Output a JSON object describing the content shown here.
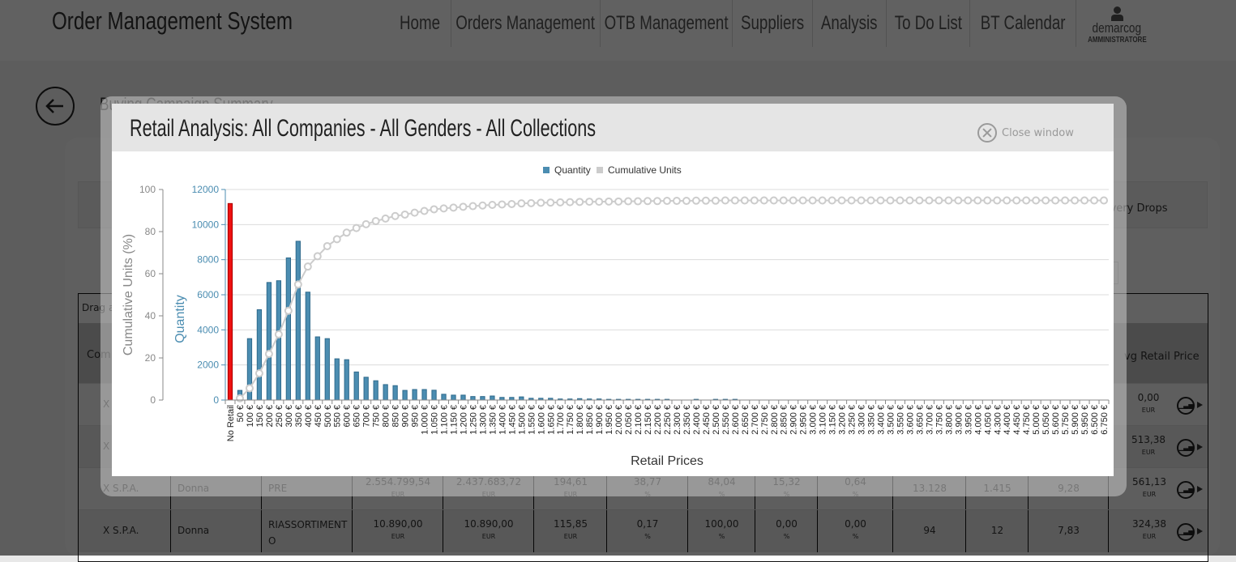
{
  "header": {
    "app_title": "Order Management System",
    "nav": [
      "Home",
      "Orders Management",
      "OTB Management",
      "Suppliers",
      "Analysis",
      "To Do List",
      "BT Calendar"
    ],
    "user": {
      "name": "demarcog",
      "role": "AMMINISTRATORE"
    }
  },
  "page": {
    "heading": "Buying Campaign Summary",
    "tab_partial": "ivery Drops",
    "grid": {
      "drag_hint": "Drag a",
      "col_company": "Comp",
      "col_avg_retail": "vg Retail Price",
      "rows": [
        {
          "company": "X",
          "gender": "",
          "type": "",
          "vals": [],
          "avg": "0,00",
          "avg_unit": "EUR"
        },
        {
          "company": "X",
          "gender": "",
          "type": "",
          "vals": [],
          "avg": "513,38",
          "avg_unit": "EUR"
        },
        {
          "company": "X S.P.A.",
          "gender": "Donna",
          "type": "PRE",
          "v1": "2.554.799,54",
          "u1": "EUR",
          "v2": "2.437.683,72",
          "u2": "EUR",
          "v3": "194,61",
          "u3": "EUR",
          "v4": "38,77",
          "u4": "%",
          "v5": "84,04",
          "u5": "%",
          "v6": "15,32",
          "u6": "%",
          "v7": "0,64",
          "u7": "%",
          "v8": "13.128",
          "v9": "1.415",
          "v10": "9,28",
          "avg": "561,13",
          "avg_unit": "EUR"
        },
        {
          "company": "X S.P.A.",
          "gender": "Donna",
          "type": "RIASSORTIMENT O",
          "v1": "10.890,00",
          "u1": "EUR",
          "v2": "10.890,00",
          "u2": "EUR",
          "v3": "115,85",
          "u3": "EUR",
          "v4": "0,17",
          "u4": "%",
          "v5": "100,00",
          "u5": "%",
          "v6": "0,00",
          "u6": "%",
          "v7": "0,00",
          "u7": "%",
          "v8": "94",
          "v9": "12",
          "v10": "7,83",
          "avg": "324,38",
          "avg_unit": "EUR"
        }
      ]
    }
  },
  "modal": {
    "title": "Retail Analysis: All Companies - All Genders - All Collections",
    "close_label": "Close window"
  },
  "colors": {
    "quantity": "#4b8db1",
    "no_retail": "#ee1111",
    "cumulative": "#cccccc"
  },
  "chart_data": {
    "type": "bar",
    "xlabel": "Retail Prices",
    "ylabel": "Quantity",
    "y2label": "Cumulative Units (%)",
    "ylim": [
      0,
      12000
    ],
    "y2lim": [
      0,
      100
    ],
    "yticks": [
      "0",
      "2000",
      "4000",
      "6000",
      "8000",
      "10000",
      "12000"
    ],
    "y2ticks": [
      "0",
      "20",
      "40",
      "60",
      "80",
      "100"
    ],
    "legend": [
      "Quantity",
      "Cumulative Units"
    ],
    "legend_position": "top-center",
    "grid": true,
    "categories": [
      "No Retail",
      "50 €",
      "100 €",
      "150 €",
      "200 €",
      "250 €",
      "300 €",
      "350 €",
      "400 €",
      "450 €",
      "500 €",
      "550 €",
      "600 €",
      "650 €",
      "700 €",
      "750 €",
      "800 €",
      "850 €",
      "900 €",
      "950 €",
      "1.000 €",
      "1.050 €",
      "1.100 €",
      "1.150 €",
      "1.200 €",
      "1.250 €",
      "1.300 €",
      "1.350 €",
      "1.400 €",
      "1.450 €",
      "1.500 €",
      "1.550 €",
      "1.600 €",
      "1.650 €",
      "1.700 €",
      "1.750 €",
      "1.800 €",
      "1.850 €",
      "1.900 €",
      "1.950 €",
      "2.000 €",
      "2.050 €",
      "2.100 €",
      "2.150 €",
      "2.200 €",
      "2.250 €",
      "2.300 €",
      "2.350 €",
      "2.400 €",
      "2.450 €",
      "2.500 €",
      "2.550 €",
      "2.600 €",
      "2.650 €",
      "2.700 €",
      "2.750 €",
      "2.800 €",
      "2.850 €",
      "2.900 €",
      "2.950 €",
      "3.000 €",
      "3.100 €",
      "3.150 €",
      "3.200 €",
      "3.250 €",
      "3.300 €",
      "3.350 €",
      "3.400 €",
      "3.500 €",
      "3.550 €",
      "3.600 €",
      "3.650 €",
      "3.700 €",
      "3.750 €",
      "3.800 €",
      "3.900 €",
      "3.950 €",
      "4.000 €",
      "4.050 €",
      "4.300 €",
      "4.400 €",
      "4.450 €",
      "4.750 €",
      "5.000 €",
      "5.050 €",
      "5.600 €",
      "5.750 €",
      "5.900 €",
      "5.950 €",
      "6.500 €",
      "6.750 €"
    ],
    "series": [
      {
        "name": "Quantity",
        "axis": "left",
        "values": [
          11200,
          550,
          3500,
          5150,
          6700,
          6800,
          8100,
          9050,
          6150,
          3600,
          3500,
          2350,
          2300,
          1600,
          1300,
          1100,
          880,
          820,
          550,
          600,
          600,
          560,
          330,
          280,
          280,
          200,
          200,
          230,
          150,
          150,
          180,
          100,
          100,
          100,
          60,
          60,
          80,
          60,
          60,
          40,
          40,
          40,
          40,
          40,
          40,
          40,
          0,
          0,
          40,
          0,
          40,
          40,
          40,
          0,
          0,
          0,
          0,
          0,
          0,
          0,
          0,
          0,
          0,
          0,
          0,
          0,
          0,
          0,
          0,
          0,
          0,
          0,
          0,
          0,
          0,
          0,
          0,
          0,
          0,
          0,
          0,
          0,
          0,
          0,
          0,
          0,
          0,
          0,
          0,
          0,
          0
        ]
      },
      {
        "name": "Cumulative Units",
        "axis": "right",
        "values": [
          null,
          0.8,
          5.6,
          12.7,
          21.9,
          31.2,
          42.4,
          54.9,
          63.4,
          68.3,
          73.1,
          76.4,
          79.5,
          81.7,
          83.5,
          85.0,
          86.2,
          87.4,
          88.1,
          89.0,
          89.8,
          90.6,
          91.0,
          91.4,
          91.8,
          92.1,
          92.4,
          92.7,
          92.9,
          93.1,
          93.4,
          93.5,
          93.7,
          93.8,
          93.9,
          94.0,
          94.1,
          94.2,
          94.2,
          94.3,
          94.3,
          94.4,
          94.4,
          94.5,
          94.5,
          94.6,
          94.6,
          94.6,
          94.7,
          94.7,
          94.7,
          94.8,
          94.8,
          94.8,
          94.8,
          94.8,
          94.8,
          94.8,
          94.8,
          94.8,
          94.8,
          94.8,
          94.8,
          94.8,
          94.8,
          94.8,
          94.8,
          94.8,
          94.8,
          94.8,
          94.8,
          94.8,
          94.8,
          94.8,
          94.8,
          94.8,
          94.8,
          94.8,
          94.8,
          94.8,
          94.8,
          94.8,
          94.8,
          94.8,
          94.8,
          94.8,
          94.8,
          94.8,
          94.8,
          94.8,
          94.8
        ]
      }
    ]
  }
}
